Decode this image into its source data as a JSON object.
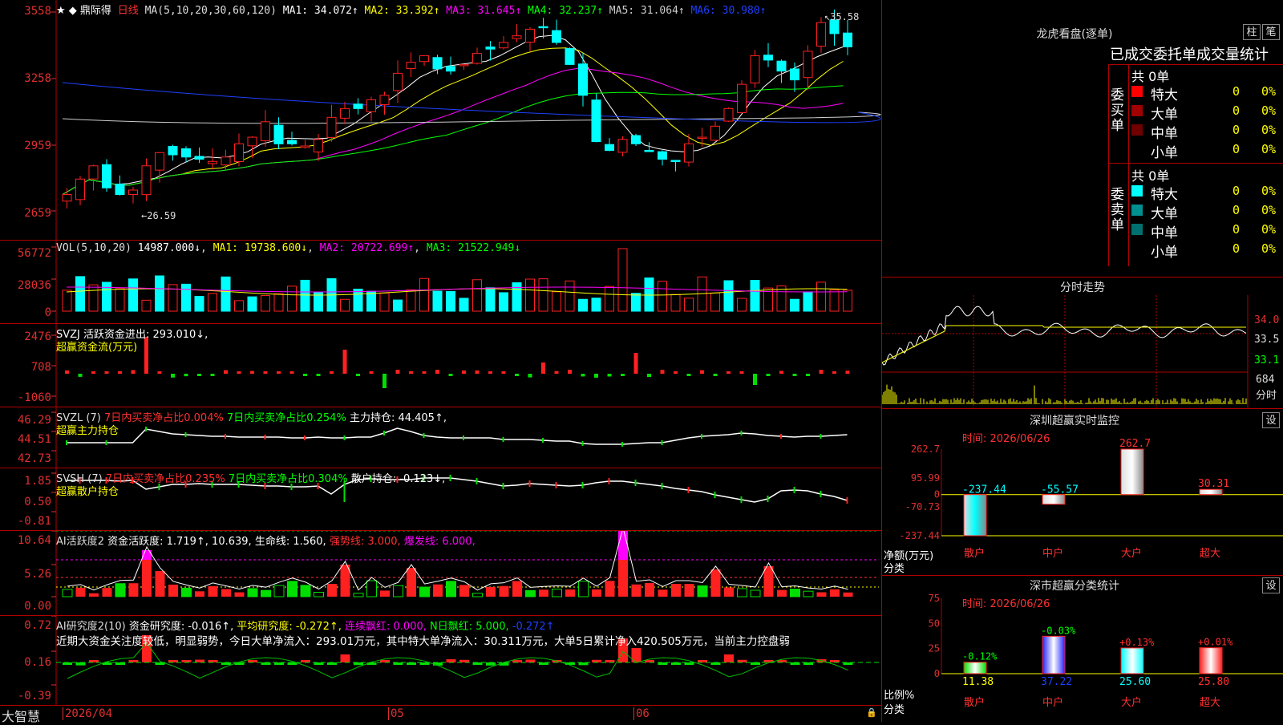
{
  "app": {
    "brand": "大智慧"
  },
  "colors": {
    "up": "#ff2020",
    "down": "#00ffff",
    "ma1": "#ffffff",
    "ma2": "#ffff00",
    "ma3": "#ff00ff",
    "ma4": "#00ff00",
    "ma5": "#cccccc",
    "ma6": "#2040ff"
  },
  "kline": {
    "title": "★ ◆ 鼎际得",
    "period": "日线",
    "ma_label": "MA(5,10,20,30,60,120)",
    "ma": [
      {
        "label": "MA1: 34.072↑"
      },
      {
        "label": "MA2: 33.392↑"
      },
      {
        "label": "MA3: 31.645↑"
      },
      {
        "label": "MA4: 32.237↑"
      },
      {
        "label": "MA5: 31.064↑"
      },
      {
        "label": "MA6: 30.980↑"
      }
    ],
    "yticks": [
      "3558",
      "3258",
      "2959",
      "2659"
    ],
    "high_mark": "35.58",
    "low_mark": "26.59"
  },
  "vol": {
    "legend_name": "VOL(5,10,20)",
    "legend_val": "14987.000↓",
    "ma1": "MA1: 19738.600↓",
    "ma2": "MA2: 20722.699↑",
    "ma3": "MA3: 21522.949↓",
    "yticks": [
      "56772",
      "28036",
      "0"
    ]
  },
  "svzj": {
    "legend": "SVZJ  活跃资金进出: 293.010↓,",
    "sub": "超赢资金流(万元)",
    "yticks": [
      "2476",
      "708",
      "-1060"
    ]
  },
  "svzl": {
    "name": "SVZL (7)",
    "a": "7日内买卖净占比0.004%",
    "b": "7日内买卖净占比0.254%",
    "c": "主力持仓: 44.405↑,",
    "sub": "超赢主力持仓",
    "yticks": [
      "46.29",
      "44.51",
      "42.73"
    ]
  },
  "svsh": {
    "name": "SVSH (7)",
    "a": "7日内买卖净占比0.235%",
    "b": "7日内买卖净占比0.304%",
    "c": "散户持仓: -0.123↓,",
    "sub": "超赢散户持仓",
    "yticks": [
      "1.85",
      "0.50",
      "-0.81"
    ]
  },
  "ai1": {
    "name": "AI活跃度2",
    "a": "资金活跃度: 1.719↑,",
    "b": "10.639,",
    "c": "生命线: 1.560,",
    "d": "强势线: 3.000,",
    "e": "爆发线: 6.000,",
    "yticks": [
      "10.64",
      "5.26",
      "0.00"
    ]
  },
  "ai2": {
    "name": "AI研究度2(10)",
    "a": "资金研究度: -0.016↑,",
    "b": "平均研究度: -0.272↑,",
    "c": "连续飘红: 0.000,",
    "d": "N日飘红: 5.000,",
    "e": "-0.272↑",
    "comment": "近期大资金关注度较低，明显弱势，今日大单净流入：293.01万元，其中特大单净流入：30.311万元，大单5日累计净入420.505万元，当前主力控盘弱",
    "yticks": [
      "0.72",
      "0.16",
      "-0.39"
    ]
  },
  "xaxis": {
    "labels": [
      "2026/04",
      "05",
      "06"
    ]
  },
  "lhb": {
    "title": "龙虎看盘(逐单)",
    "btn1": "柱",
    "btn2": "笔",
    "tabs": "已成交委托单成交量统计",
    "buy_side": "委买单",
    "sell_side": "委卖单",
    "buy_total": "共 0单",
    "sell_total": "共 0单",
    "buy_rows": [
      {
        "label": "特大",
        "count": "0",
        "pct": "0%",
        "color": "#ff0000"
      },
      {
        "label": "大单",
        "count": "0",
        "pct": "0%",
        "color": "#a00000"
      },
      {
        "label": "中单",
        "count": "0",
        "pct": "0%",
        "color": "#700000"
      },
      {
        "label": "小单",
        "count": "0",
        "pct": "0%",
        "color": "#000000"
      }
    ],
    "sell_rows": [
      {
        "label": "特大",
        "count": "0",
        "pct": "0%",
        "color": "#00ffff"
      },
      {
        "label": "大单",
        "count": "0",
        "pct": "0%",
        "color": "#009090"
      },
      {
        "label": "中单",
        "count": "0",
        "pct": "0%",
        "color": "#007070"
      },
      {
        "label": "小单",
        "count": "0",
        "pct": "0%",
        "color": "#000000"
      }
    ]
  },
  "intraday": {
    "title": "分时走势",
    "yticks": [
      "34.0",
      "33.5",
      "33.1"
    ],
    "vol_tick": "684",
    "footer": "分时"
  },
  "monitor": {
    "title": "深圳超赢实时监控",
    "set": "设",
    "time": "时间: 2026/06/26",
    "yticks": [
      "262.7",
      "95.99",
      "0",
      "-70.73",
      "-237.44"
    ],
    "ylabel1": "净额(万元)",
    "ylabel2": "分类",
    "categories": [
      "散户",
      "中户",
      "大户",
      "超大"
    ],
    "values": [
      -237.44,
      -55.57,
      262.7,
      30.31
    ],
    "value_labels": [
      "-237.44",
      "-55.57",
      "262.7",
      "30.31"
    ]
  },
  "classify": {
    "title": "深市超赢分类统计",
    "set": "设",
    "time": "时间: 2026/06/26",
    "yticks": [
      "75",
      "50",
      "25",
      "0"
    ],
    "ylabel1": "比例%",
    "ylabel2": "分类",
    "categories": [
      "散户",
      "中户",
      "大户",
      "超大"
    ],
    "values": [
      11.38,
      37.22,
      25.6,
      25.8
    ],
    "value_labels": [
      "11.38",
      "37.22",
      "25.60",
      "25.80"
    ],
    "change_labels": [
      "-0.12%",
      "-0.03%",
      "+0.13%",
      "+0.01%"
    ]
  },
  "chart_data": {
    "type": "bar",
    "categories": [
      "散户",
      "中户",
      "大户",
      "超大"
    ],
    "series": [
      {
        "name": "净额(万元)",
        "values": [
          -237.44,
          -55.57,
          262.7,
          30.31
        ]
      },
      {
        "name": "比例%",
        "values": [
          11.38,
          37.22,
          25.6,
          25.8
        ]
      }
    ]
  }
}
